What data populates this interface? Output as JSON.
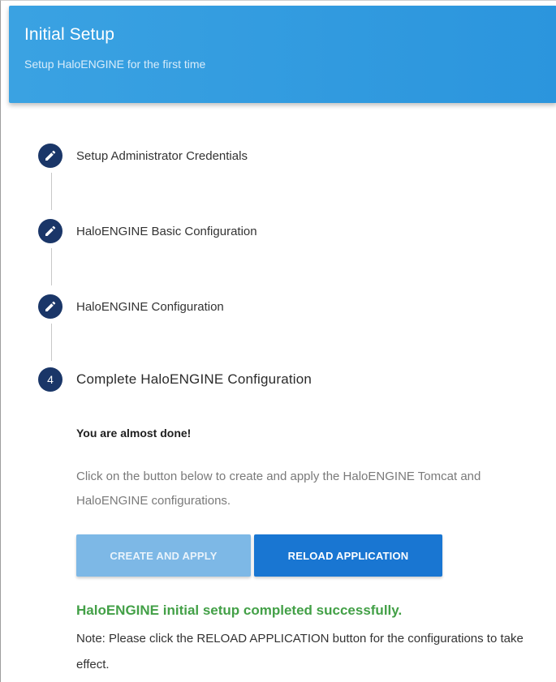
{
  "header": {
    "title": "Initial Setup",
    "subtitle": "Setup HaloENGINE for the first time"
  },
  "steps": [
    {
      "badge": "edit-icon",
      "label": "Setup Administrator Credentials",
      "state": "completed"
    },
    {
      "badge": "edit-icon",
      "label": "HaloENGINE Basic Configuration",
      "state": "completed"
    },
    {
      "badge": "edit-icon",
      "label": "HaloENGINE Configuration",
      "state": "completed"
    },
    {
      "number": "4",
      "label": "Complete HaloENGINE Configuration",
      "state": "active"
    }
  ],
  "content": {
    "heading": "You are almost done!",
    "description": "Click on the button below to create and apply the HaloENGINE Tomcat and HaloENGINE configurations.",
    "create_button": "CREATE AND APPLY",
    "reload_button": "RELOAD APPLICATION",
    "success_message": "HaloENGINE initial setup completed successfully.",
    "note": "Note: Please click the RELOAD APPLICATION button for the configurations to take effect."
  },
  "colors": {
    "header": "#2b95dd",
    "step_badge": "#1a3668",
    "primary_button": "#1976d2",
    "disabled_button": "#7db8e6",
    "success": "#43a047"
  }
}
